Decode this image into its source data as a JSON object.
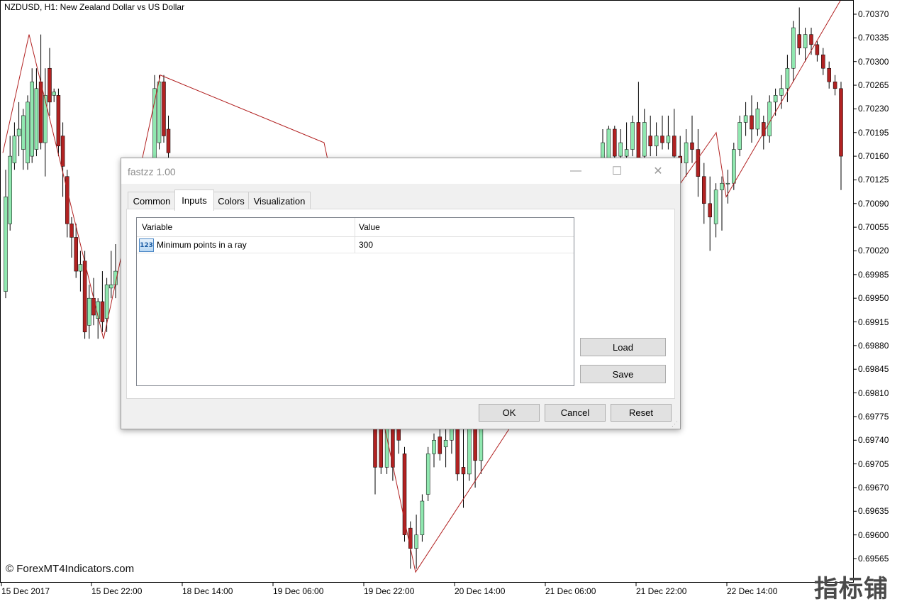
{
  "chart": {
    "title": "NZDUSD, H1:  New Zealand Dollar vs US Dollar",
    "watermark": "© ForexMT4Indicators.com",
    "corner_mark": "指标铺",
    "price_labels": [
      "0.70370",
      "0.70335",
      "0.70300",
      "0.70265",
      "0.70230",
      "0.70195",
      "0.70160",
      "0.70125",
      "0.70090",
      "0.70055",
      "0.70020",
      "0.69985",
      "0.69950",
      "0.69915",
      "0.69880",
      "0.69845",
      "0.69810",
      "0.69775",
      "0.69740",
      "0.69705",
      "0.69670",
      "0.69635",
      "0.69600",
      "0.69565"
    ],
    "time_labels": [
      "15 Dec 2017",
      "15 Dec 22:00",
      "18 Dec 14:00",
      "19 Dec 06:00",
      "19 Dec 22:00",
      "20 Dec 14:00",
      "21 Dec 06:00",
      "21 Dec 22:00",
      "22 Dec 14:00"
    ],
    "colors": {
      "bull": "#90e8b0",
      "bear": "#b22222",
      "zigzag": "#b22222",
      "wick": "#000000"
    }
  },
  "chart_data": {
    "type": "candlestick",
    "title": "NZDUSD, H1:  New Zealand Dollar vs US Dollar",
    "y_range": [
      0.69545,
      0.7039
    ],
    "x_labels": [
      "15 Dec 2017",
      "15 Dec 22:00",
      "18 Dec 14:00",
      "19 Dec 06:00",
      "19 Dec 22:00",
      "20 Dec 14:00",
      "21 Dec 06:00",
      "21 Dec 22:00",
      "22 Dec 14:00"
    ],
    "zigzag": [
      {
        "x": "15 Dec 2017",
        "price": 0.70165
      },
      {
        "x": "15 Dec 2017 +5h",
        "price": 0.7034
      },
      {
        "x": "15 Dec 22:00 -4h",
        "price": 0.6989
      },
      {
        "x": "18 Dec 06:00",
        "price": 0.7028
      },
      {
        "x": "19 Dec 06:00",
        "price": 0.7018
      },
      {
        "x": "19 Dec 22:00 +9h",
        "price": 0.69545
      },
      {
        "x": "20 Dec 14:00",
        "price": 0.698
      },
      {
        "x": "21 Dec 06:00",
        "price": 0.70195
      },
      {
        "x": "21 Dec 22:00",
        "price": 0.701
      },
      {
        "x": "22 Dec 14:00 +20h",
        "price": 0.7039
      }
    ],
    "candles": [
      {
        "o": 0.6996,
        "h": 0.7014,
        "l": 0.6995,
        "c": 0.701
      },
      {
        "o": 0.7006,
        "h": 0.7019,
        "l": 0.7005,
        "c": 0.7016
      },
      {
        "o": 0.7015,
        "h": 0.7021,
        "l": 0.7014,
        "c": 0.7019
      },
      {
        "o": 0.7019,
        "h": 0.7024,
        "l": 0.7016,
        "c": 0.702
      },
      {
        "o": 0.7017,
        "h": 0.7023,
        "l": 0.7014,
        "c": 0.7022
      },
      {
        "o": 0.7015,
        "h": 0.7025,
        "l": 0.7014,
        "c": 0.7024
      },
      {
        "o": 0.7016,
        "h": 0.7029,
        "l": 0.7015,
        "c": 0.7027
      },
      {
        "o": 0.7017,
        "h": 0.7029,
        "l": 0.7016,
        "c": 0.7026
      },
      {
        "o": 0.7027,
        "h": 0.7034,
        "l": 0.7017,
        "c": 0.7018
      },
      {
        "o": 0.7018,
        "h": 0.7029,
        "l": 0.7013,
        "c": 0.7025
      },
      {
        "o": 0.7029,
        "h": 0.7032,
        "l": 0.7022,
        "c": 0.7024
      },
      {
        "o": 0.7025,
        "h": 0.7026,
        "l": 0.7024,
        "c": 0.70255
      },
      {
        "o": 0.7025,
        "h": 0.7026,
        "l": 0.7016,
        "c": 0.70175
      },
      {
        "o": 0.7019,
        "h": 0.7021,
        "l": 0.701,
        "c": 0.70145
      },
      {
        "o": 0.7013,
        "h": 0.7014,
        "l": 0.7004,
        "c": 0.7006
      },
      {
        "o": 0.7006,
        "h": 0.7007,
        "l": 0.7001,
        "c": 0.7004
      },
      {
        "o": 0.7004,
        "h": 0.7006,
        "l": 0.6998,
        "c": 0.6999
      },
      {
        "o": 0.6999,
        "h": 0.7002,
        "l": 0.6996,
        "c": 0.7
      },
      {
        "o": 0.70005,
        "h": 0.7002,
        "l": 0.6989,
        "c": 0.699
      },
      {
        "o": 0.6991,
        "h": 0.6997,
        "l": 0.6989,
        "c": 0.6995
      },
      {
        "o": 0.6995,
        "h": 0.6998,
        "l": 0.6991,
        "c": 0.69925
      },
      {
        "o": 0.6992,
        "h": 0.6995,
        "l": 0.6989,
        "c": 0.69945
      },
      {
        "o": 0.69945,
        "h": 0.6999,
        "l": 0.699,
        "c": 0.69915
      },
      {
        "o": 0.6992,
        "h": 0.6998,
        "l": 0.699,
        "c": 0.6997
      },
      {
        "o": 0.69965,
        "h": 0.7002,
        "l": 0.6995,
        "c": 0.6997
      },
      {
        "o": 0.6997,
        "h": 0.7003,
        "l": 0.6995,
        "c": 0.6999
      },
      {
        "o": 0.701,
        "h": 0.7028,
        "l": 0.7009,
        "c": 0.7026
      },
      {
        "o": 0.7018,
        "h": 0.7028,
        "l": 0.7017,
        "c": 0.7027
      },
      {
        "o": 0.7027,
        "h": 0.7028,
        "l": 0.7018,
        "c": 0.7019
      },
      {
        "o": 0.702,
        "h": 0.7022,
        "l": 0.7015,
        "c": 0.70165
      },
      {
        "o": 0.6977,
        "h": 0.6979,
        "l": 0.6966,
        "c": 0.697
      },
      {
        "o": 0.6979,
        "h": 0.698,
        "l": 0.6969,
        "c": 0.697
      },
      {
        "o": 0.697,
        "h": 0.6979,
        "l": 0.6969,
        "c": 0.6978
      },
      {
        "o": 0.6978,
        "h": 0.6979,
        "l": 0.6968,
        "c": 0.697
      },
      {
        "o": 0.6979,
        "h": 0.698,
        "l": 0.6972,
        "c": 0.6974
      },
      {
        "o": 0.6972,
        "h": 0.6973,
        "l": 0.6959,
        "c": 0.696
      },
      {
        "o": 0.6961,
        "h": 0.6962,
        "l": 0.6955,
        "c": 0.6958
      },
      {
        "o": 0.6958,
        "h": 0.6963,
        "l": 0.6955,
        "c": 0.696
      },
      {
        "o": 0.696,
        "h": 0.6966,
        "l": 0.6959,
        "c": 0.6965
      },
      {
        "o": 0.6966,
        "h": 0.6973,
        "l": 0.6965,
        "c": 0.6972
      },
      {
        "o": 0.6972,
        "h": 0.6975,
        "l": 0.697,
        "c": 0.6974
      },
      {
        "o": 0.69745,
        "h": 0.6977,
        "l": 0.6971,
        "c": 0.6972
      },
      {
        "o": 0.6973,
        "h": 0.6978,
        "l": 0.697,
        "c": 0.6974
      },
      {
        "o": 0.6974,
        "h": 0.698,
        "l": 0.6972,
        "c": 0.6978
      },
      {
        "o": 0.6978,
        "h": 0.698,
        "l": 0.6968,
        "c": 0.6969
      },
      {
        "o": 0.697,
        "h": 0.698,
        "l": 0.6964,
        "c": 0.6969
      },
      {
        "o": 0.6969,
        "h": 0.6979,
        "l": 0.6968,
        "c": 0.6978
      },
      {
        "o": 0.6978,
        "h": 0.6979,
        "l": 0.6967,
        "c": 0.6971
      },
      {
        "o": 0.6971,
        "h": 0.6979,
        "l": 0.6969,
        "c": 0.6978
      },
      {
        "o": 0.7014,
        "h": 0.702,
        "l": 0.7008,
        "c": 0.7018
      },
      {
        "o": 0.7014,
        "h": 0.70205,
        "l": 0.7013,
        "c": 0.702
      },
      {
        "o": 0.702,
        "h": 0.70205,
        "l": 0.7014,
        "c": 0.7016
      },
      {
        "o": 0.7016,
        "h": 0.702,
        "l": 0.7014,
        "c": 0.7018
      },
      {
        "o": 0.7016,
        "h": 0.7021,
        "l": 0.7015,
        "c": 0.7017
      },
      {
        "o": 0.7017,
        "h": 0.7022,
        "l": 0.7016,
        "c": 0.7021
      },
      {
        "o": 0.7021,
        "h": 0.7027,
        "l": 0.7014,
        "c": 0.7015
      },
      {
        "o": 0.7016,
        "h": 0.7023,
        "l": 0.7015,
        "c": 0.7021
      },
      {
        "o": 0.7019,
        "h": 0.7022,
        "l": 0.7016,
        "c": 0.70175
      },
      {
        "o": 0.70175,
        "h": 0.7021,
        "l": 0.7016,
        "c": 0.7019
      },
      {
        "o": 0.7019,
        "h": 0.7022,
        "l": 0.7017,
        "c": 0.7018
      },
      {
        "o": 0.7018,
        "h": 0.7022,
        "l": 0.7017,
        "c": 0.7019
      },
      {
        "o": 0.7019,
        "h": 0.7023,
        "l": 0.7014,
        "c": 0.7016
      },
      {
        "o": 0.7016,
        "h": 0.7019,
        "l": 0.7013,
        "c": 0.7015
      },
      {
        "o": 0.7015,
        "h": 0.702,
        "l": 0.7013,
        "c": 0.7018
      },
      {
        "o": 0.7018,
        "h": 0.7022,
        "l": 0.7015,
        "c": 0.7017
      },
      {
        "o": 0.7017,
        "h": 0.702,
        "l": 0.701,
        "c": 0.7013
      },
      {
        "o": 0.7013,
        "h": 0.7015,
        "l": 0.7006,
        "c": 0.7009
      },
      {
        "o": 0.7009,
        "h": 0.7013,
        "l": 0.7002,
        "c": 0.7007
      },
      {
        "o": 0.7006,
        "h": 0.7012,
        "l": 0.7004,
        "c": 0.7011
      },
      {
        "o": 0.7011,
        "h": 0.7013,
        "l": 0.7005,
        "c": 0.7012
      },
      {
        "o": 0.7012,
        "h": 0.7014,
        "l": 0.7009,
        "c": 0.7012
      },
      {
        "o": 0.7012,
        "h": 0.7018,
        "l": 0.7011,
        "c": 0.7017
      },
      {
        "o": 0.7017,
        "h": 0.7022,
        "l": 0.7016,
        "c": 0.7021
      },
      {
        "o": 0.7021,
        "h": 0.7024,
        "l": 0.7019,
        "c": 0.7022
      },
      {
        "o": 0.7022,
        "h": 0.7025,
        "l": 0.7018,
        "c": 0.702
      },
      {
        "o": 0.702,
        "h": 0.7024,
        "l": 0.7019,
        "c": 0.7023
      },
      {
        "o": 0.7021,
        "h": 0.7022,
        "l": 0.7017,
        "c": 0.7019
      },
      {
        "o": 0.7019,
        "h": 0.7025,
        "l": 0.7018,
        "c": 0.7024
      },
      {
        "o": 0.7024,
        "h": 0.7026,
        "l": 0.7022,
        "c": 0.7025
      },
      {
        "o": 0.7025,
        "h": 0.7028,
        "l": 0.7023,
        "c": 0.7026
      },
      {
        "o": 0.7026,
        "h": 0.7031,
        "l": 0.7024,
        "c": 0.7029
      },
      {
        "o": 0.7029,
        "h": 0.7036,
        "l": 0.7027,
        "c": 0.7035
      },
      {
        "o": 0.7034,
        "h": 0.7038,
        "l": 0.7031,
        "c": 0.7032
      },
      {
        "o": 0.7032,
        "h": 0.7035,
        "l": 0.703,
        "c": 0.7034
      },
      {
        "o": 0.7034,
        "h": 0.7035,
        "l": 0.7031,
        "c": 0.70325
      },
      {
        "o": 0.70325,
        "h": 0.7033,
        "l": 0.703,
        "c": 0.7031
      },
      {
        "o": 0.7031,
        "h": 0.7032,
        "l": 0.7028,
        "c": 0.7029
      },
      {
        "o": 0.7029,
        "h": 0.703,
        "l": 0.7026,
        "c": 0.7027
      },
      {
        "o": 0.7027,
        "h": 0.7028,
        "l": 0.7025,
        "c": 0.7026
      },
      {
        "o": 0.7026,
        "h": 0.7027,
        "l": 0.7011,
        "c": 0.7016
      }
    ]
  },
  "dialog": {
    "title": "fastzz 1.00",
    "tabs": [
      {
        "label": "Common"
      },
      {
        "label": "Inputs"
      },
      {
        "label": "Colors"
      },
      {
        "label": "Visualization"
      }
    ],
    "active_tab": "Inputs",
    "grid": {
      "headers": {
        "variable": "Variable",
        "value": "Value"
      },
      "rows": [
        {
          "icon": "123",
          "variable": "Minimum points in a ray",
          "value": "300"
        }
      ]
    },
    "buttons": {
      "load": "Load",
      "save": "Save",
      "ok": "OK",
      "cancel": "Cancel",
      "reset": "Reset"
    }
  }
}
